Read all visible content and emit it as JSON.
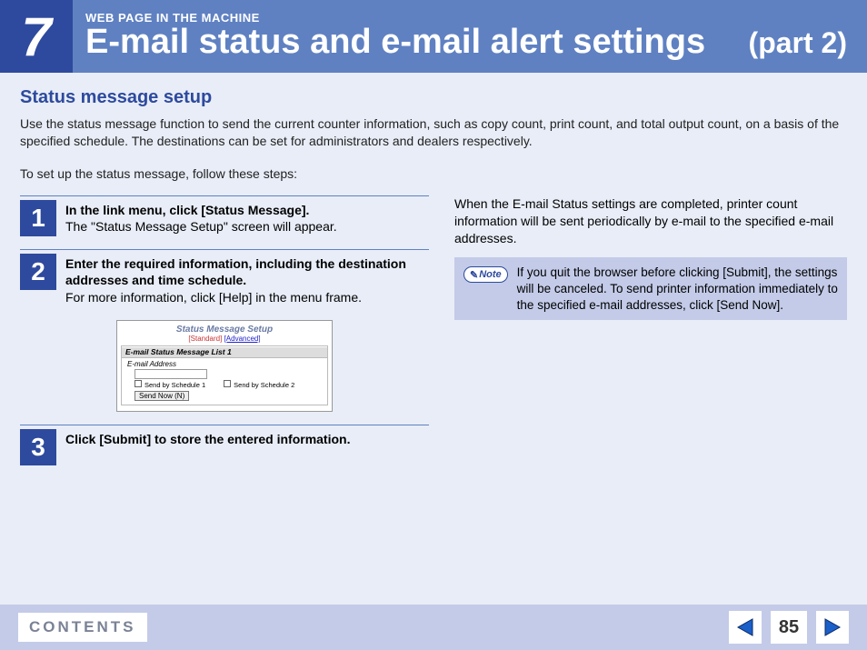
{
  "header": {
    "chapter_number": "7",
    "subtitle": "WEB PAGE IN THE MACHINE",
    "title": "E-mail status and e-mail alert settings",
    "part": "(part 2)"
  },
  "section": {
    "title": "Status message setup",
    "intro": "Use the status message function to send the current counter information, such as copy count, print count, and total output count, on a basis of the specified schedule. The destinations can be set for administrators and dealers respectively.",
    "lead": "To set up the status message, follow these steps:"
  },
  "steps": [
    {
      "num": "1",
      "title": "In the link menu, click [Status Message].",
      "sub": "The \"Status Message Setup\" screen will appear."
    },
    {
      "num": "2",
      "title": "Enter the required information, including the destination addresses and time schedule.",
      "sub": "For more information, click [Help] in the menu frame."
    },
    {
      "num": "3",
      "title": "Click [Submit] to store the entered information.",
      "sub": ""
    }
  ],
  "screenshot": {
    "title": "Status Message Setup",
    "tab_active": "[Standard]",
    "tab_link": "[Advanced]",
    "panel_title": "E-mail Status Message List 1",
    "field_label": "E-mail Address",
    "check1": "Send by Schedule 1",
    "check2": "Send by Schedule 2",
    "button": "Send Now (N)"
  },
  "right": {
    "text": "When the E-mail Status settings are completed, printer count information will be sent periodically by e-mail to the specified e-mail addresses.",
    "note_label": "Note",
    "note_text": "If you quit the browser before clicking [Submit], the settings will be canceled. To send printer information immediately to the specified e-mail addresses, click [Send Now]."
  },
  "footer": {
    "contents": "CONTENTS",
    "page": "85"
  }
}
